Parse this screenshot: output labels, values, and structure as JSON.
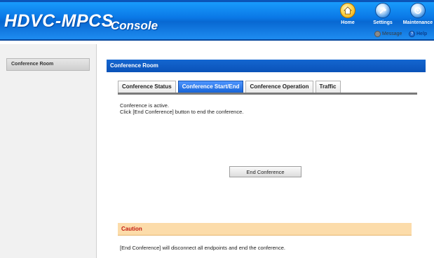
{
  "header": {
    "logo": "HDVC-MPCS",
    "title": "Console",
    "nav": [
      {
        "label": "Home",
        "icon": "home-icon"
      },
      {
        "label": "Settings",
        "icon": "settings-icon"
      },
      {
        "label": "Maintenance",
        "icon": "maintenance-icon"
      }
    ],
    "links": [
      {
        "label": "Message",
        "icon": "message-icon"
      },
      {
        "label": "Help",
        "icon": "help-icon"
      }
    ]
  },
  "sidebar": {
    "items": [
      {
        "label": "Conference Room"
      }
    ]
  },
  "main": {
    "section_title": "Conference Room",
    "tabs": [
      {
        "label": "Conference Status",
        "active": false
      },
      {
        "label": "Conference Start/End",
        "active": true
      },
      {
        "label": "Conference Operation",
        "active": false
      },
      {
        "label": "Traffic",
        "active": false
      }
    ],
    "messages": [
      "Conference is active.",
      "Click [End Conference] button to end the conference."
    ],
    "end_button": "End Conference",
    "caution_title": "Caution",
    "caution_text": "[End Conference] will disconnect all endpoints and end the conference."
  },
  "colors": {
    "header_blue": "#0a78e6",
    "section_bar": "#0a52b8",
    "active_tab": "#1663d6",
    "caution_bg": "#fcdcaa",
    "caution_text": "#c21a10"
  }
}
